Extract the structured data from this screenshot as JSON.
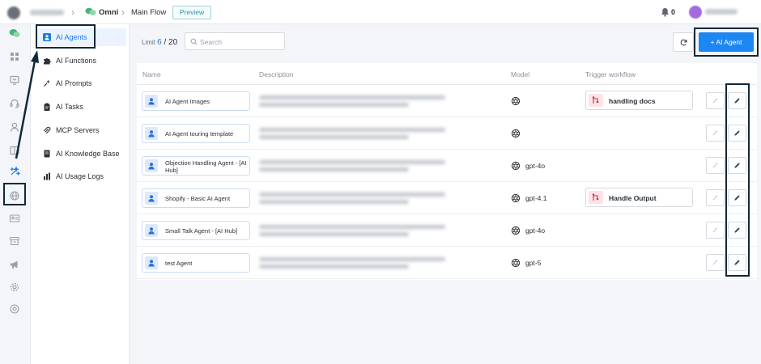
{
  "header": {
    "workspace_name": "",
    "breadcrumb": [
      "Omni",
      "Main Flow"
    ],
    "preview_label": "Preview",
    "notifications_count": "0",
    "user_name": ""
  },
  "rail": {
    "icons": [
      "chat-icon",
      "grid-icon",
      "broadcast-icon",
      "support-icon",
      "contacts-icon",
      "book-icon",
      "ai-sparkle-icon",
      "globe-icon",
      "id-card-icon",
      "archive-icon",
      "megaphone-icon",
      "settings-icon",
      "help-icon"
    ],
    "active": "ai-sparkle-icon"
  },
  "submenu": {
    "items": [
      {
        "label": "AI Agents",
        "icon": "agent-icon",
        "active": true
      },
      {
        "label": "AI Functions",
        "icon": "puzzle-icon",
        "active": false
      },
      {
        "label": "AI Prompts",
        "icon": "sparkle-icon",
        "active": false
      },
      {
        "label": "AI Tasks",
        "icon": "clipboard-icon",
        "active": false
      },
      {
        "label": "MCP Servers",
        "icon": "mcp-icon",
        "active": false
      },
      {
        "label": "AI Knowledge Base",
        "icon": "knowledge-icon",
        "active": false
      },
      {
        "label": "AI Usage Logs",
        "icon": "bar-chart-icon",
        "active": false
      }
    ]
  },
  "toolbar": {
    "limit_label": "Limit",
    "limit_used": "6",
    "limit_total": "20",
    "search_placeholder": "Search",
    "add_agent_label": "AI Agent"
  },
  "table": {
    "columns": [
      "Name",
      "Description",
      "Model",
      "Trigger workflow"
    ],
    "rows": [
      {
        "name": "AI Agent Images",
        "model": "",
        "workflow": "handling docs"
      },
      {
        "name": "AI Agent touring template",
        "model": "",
        "workflow": ""
      },
      {
        "name": "Objection Handling Agent - [AI Hub]",
        "model": "gpt-4o",
        "workflow": ""
      },
      {
        "name": "Shopify - Basic AI Agent",
        "model": "gpt-4.1",
        "workflow": "Handle Output"
      },
      {
        "name": "Small Talk Agent - [AI Hub]",
        "model": "gpt-4o",
        "workflow": ""
      },
      {
        "name": "test Agent",
        "model": "gpt-5",
        "workflow": ""
      }
    ]
  },
  "colors": {
    "accent": "#1c86f2",
    "annotation": "#10293a",
    "workflow_icon_bg": "#fde3e6"
  }
}
